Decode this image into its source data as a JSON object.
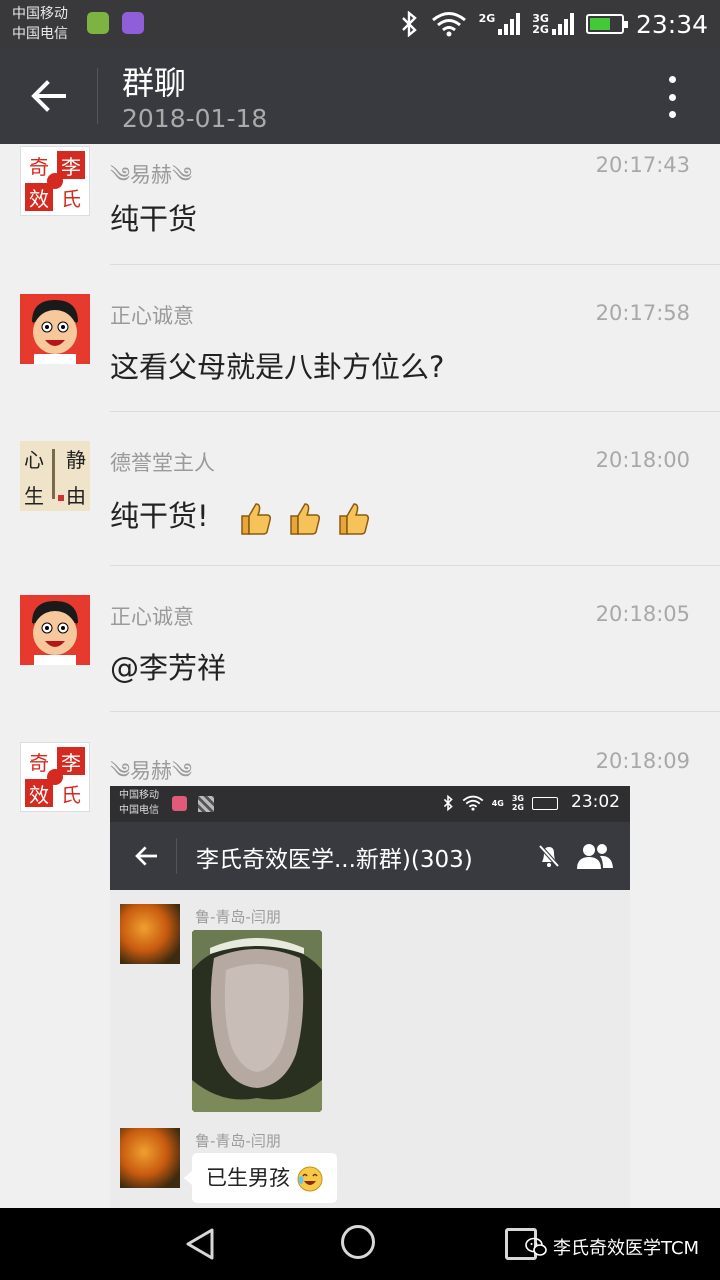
{
  "status_bar": {
    "carrier_1": "中国移动",
    "carrier_2": "中国电信",
    "network_1": "2G",
    "network_2a": "3G",
    "network_2b": "2G",
    "time": "23:34",
    "battery_level": 0.7,
    "icons": [
      "bluetooth-icon",
      "wifi-icon",
      "signal-icon",
      "battery-charging-icon"
    ]
  },
  "header": {
    "title": "群聊",
    "subtitle": "2018-01-18"
  },
  "messages": [
    {
      "sender": "༄易赫༄",
      "time": "20:17:43",
      "text": "纯干货",
      "avatar": "qi-seal-avatar"
    },
    {
      "sender": "正心诚意",
      "time": "20:17:58",
      "text": "这看父母就是八卦方位么?",
      "avatar": "cartoon-boy-avatar"
    },
    {
      "sender": "德誉堂主人",
      "time": "20:18:00",
      "text": "纯干货!",
      "avatar": "calligraphy-avatar",
      "emoji": [
        "thumbs-up-icon",
        "thumbs-up-icon",
        "thumbs-up-icon"
      ]
    },
    {
      "sender": "正心诚意",
      "time": "20:18:05",
      "text": "@李芳祥",
      "avatar": "cartoon-boy-avatar"
    },
    {
      "sender": "༄易赫༄",
      "time": "20:18:09",
      "text": "",
      "avatar": "qi-seal-avatar"
    }
  ],
  "screenshot": {
    "carrier_1": "中国移动",
    "carrier_2": "中国电信",
    "network_1": "4G",
    "network_2a": "3G",
    "network_2b": "2G",
    "time": "23:02",
    "title": "李氏奇效医学...新群)(303)",
    "messages": [
      {
        "sender": "鲁-青岛-闫朋",
        "type": "image",
        "image": "tongue-photo"
      },
      {
        "sender": "鲁-青岛-闫朋",
        "type": "text",
        "text": "已生男孩",
        "emoji": "laughing-face-icon"
      }
    ]
  },
  "watermark": {
    "text": "李氏奇效医学TCM",
    "icon": "wechat-icon"
  },
  "colors": {
    "titlebar": "#393a3f",
    "statusbar": "#39393b",
    "background": "#f0f0f0",
    "battery": "#45c83a"
  }
}
